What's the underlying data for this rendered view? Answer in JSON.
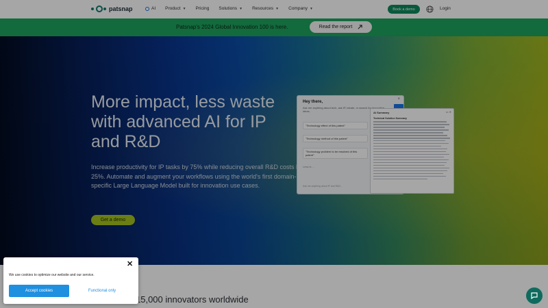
{
  "nav": {
    "brand": "patsnap",
    "links": [
      {
        "label": "AI",
        "has_chevron": false
      },
      {
        "label": "Product",
        "has_chevron": true
      },
      {
        "label": "Pricing",
        "has_chevron": false
      },
      {
        "label": "Solutions",
        "has_chevron": true
      },
      {
        "label": "Resources",
        "has_chevron": true
      },
      {
        "label": "Company",
        "has_chevron": true
      }
    ],
    "cta_label": "Book a demo",
    "login_label": "Login",
    "globe_icon": "globe-icon"
  },
  "banner": {
    "text": "Patsnap's 2024 Global Innovation 100 is here.",
    "button_label": "Read the report",
    "button_icon": "arrow-up-right-icon"
  },
  "hero": {
    "title": "More impact, less waste with advanced AI for IP and R&D",
    "subtitle": "Increase productivity for IP tasks by 75% while reducing overall R&D costs by 25%. Automate and augment your workflows using the world's first domain-specific Large Language Model built for innovation use cases.",
    "cta_label": "Get a demo"
  },
  "mock_chat": {
    "greeting": "Hey there,",
    "hint": "Ask me anything about tech, ask IP, ideate, or search for innovative ideas.",
    "prompts": [
      "\"Technology effect of this patent\"",
      "\"Technology method of this patent\"",
      "\"Technology problem to be resolved of this patent\""
    ],
    "footer": "Less is ...",
    "input_placeholder": "Ask me anything about IP and R&D..."
  },
  "mock_summary": {
    "header": "AI Summary",
    "title": "Technical Solution Summary"
  },
  "below": {
    "innovators_text": "15,000 innovators worldwide"
  },
  "cookie": {
    "message": "We use cookies to optimize our website and our service.",
    "accept_label": "Accept cookies",
    "functional_label": "Functional only"
  },
  "colors": {
    "brand_green": "#0f8a5f",
    "banner_green": "#1ea35c",
    "cta_lime": "#a5c21e",
    "cookie_blue": "#1f8fe0"
  }
}
